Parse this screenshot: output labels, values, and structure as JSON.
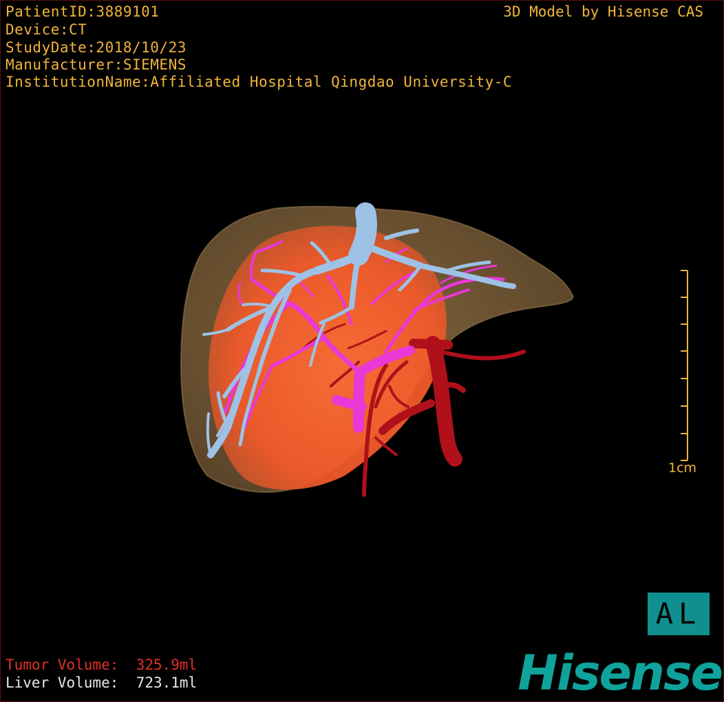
{
  "header": {
    "patient_id": "PatientID:3889101",
    "device": "Device:CT",
    "study_date": "StudyDate:2018/10/23",
    "manufacturer": "Manufacturer:SIEMENS",
    "institution": "InstitutionName:Affiliated Hospital Qingdao University-C",
    "model_credit": "3D Model by Hisense CAS"
  },
  "scale": {
    "label": "1cm"
  },
  "orientation": {
    "label": "AL"
  },
  "volumes": {
    "tumor_label": "Tumor Volume:",
    "tumor_value": "325.9ml",
    "liver_label": "Liver Volume:",
    "liver_value": "723.1ml"
  },
  "brand": {
    "logo_text": "Hisense"
  },
  "colors": {
    "info_text": "#f2b53a",
    "tumor_text": "#e2302a",
    "liver_tissue": "#8a6a3e",
    "tumor": "#ff6a30",
    "hepatic_vein": "#9ec2e6",
    "portal_vein": "#e838d8",
    "artery_ivc": "#b0101a",
    "orientation_box": "#0f8f8f",
    "brand": "#0fa39c"
  }
}
